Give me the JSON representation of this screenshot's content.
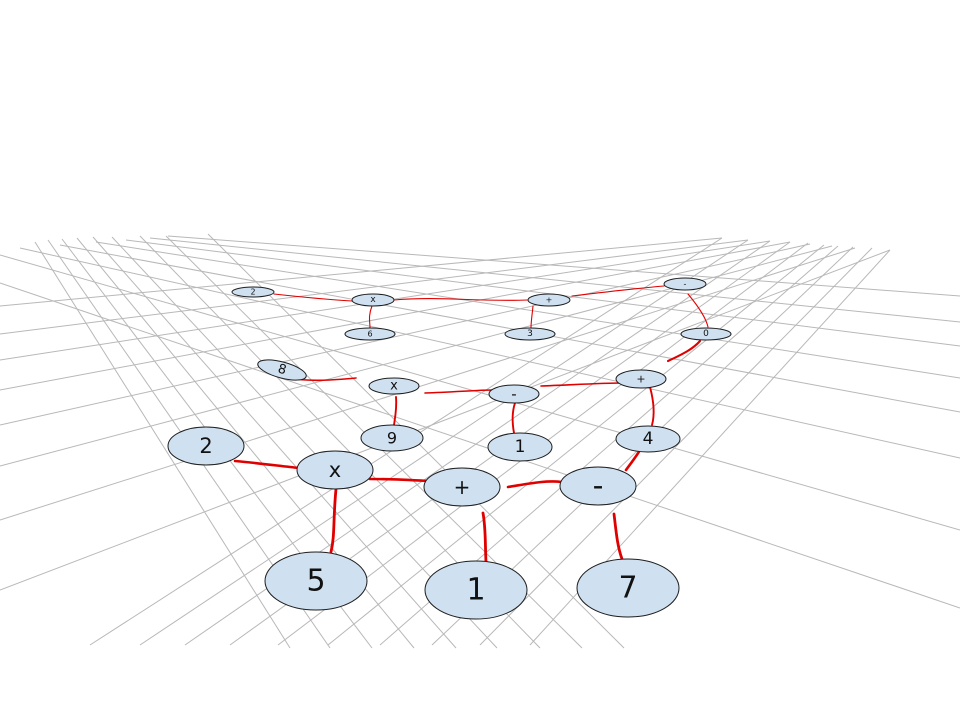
{
  "colors": {
    "background": "#ffffff",
    "grid": "#b8b8b8",
    "edge": "#e00000",
    "node_fill": "#cfe0f1",
    "node_stroke": "#1e1e1e"
  },
  "trees": [
    {
      "row": "far",
      "nodes": [
        {
          "id": "f_a",
          "label": "2"
        },
        {
          "id": "f_b",
          "label": "x"
        },
        {
          "id": "f_c",
          "label": "6"
        },
        {
          "id": "f_d",
          "label": "+"
        },
        {
          "id": "f_e",
          "label": "3"
        },
        {
          "id": "f_f",
          "label": "-"
        },
        {
          "id": "f_g",
          "label": "0"
        }
      ]
    },
    {
      "row": "middle",
      "nodes": [
        {
          "id": "m_a",
          "label": "8"
        },
        {
          "id": "m_b",
          "label": "x"
        },
        {
          "id": "m_c",
          "label": "9"
        },
        {
          "id": "m_d",
          "label": "-"
        },
        {
          "id": "m_e",
          "label": "1"
        },
        {
          "id": "m_f",
          "label": "+"
        },
        {
          "id": "m_g",
          "label": "4"
        }
      ]
    },
    {
      "row": "near",
      "nodes": [
        {
          "id": "n_a",
          "label": "2"
        },
        {
          "id": "n_b",
          "label": "x"
        },
        {
          "id": "n_c",
          "label": "5"
        },
        {
          "id": "n_d",
          "label": "+"
        },
        {
          "id": "n_e",
          "label": "1"
        },
        {
          "id": "n_f",
          "label": "-"
        },
        {
          "id": "n_g",
          "label": "7"
        }
      ]
    }
  ]
}
